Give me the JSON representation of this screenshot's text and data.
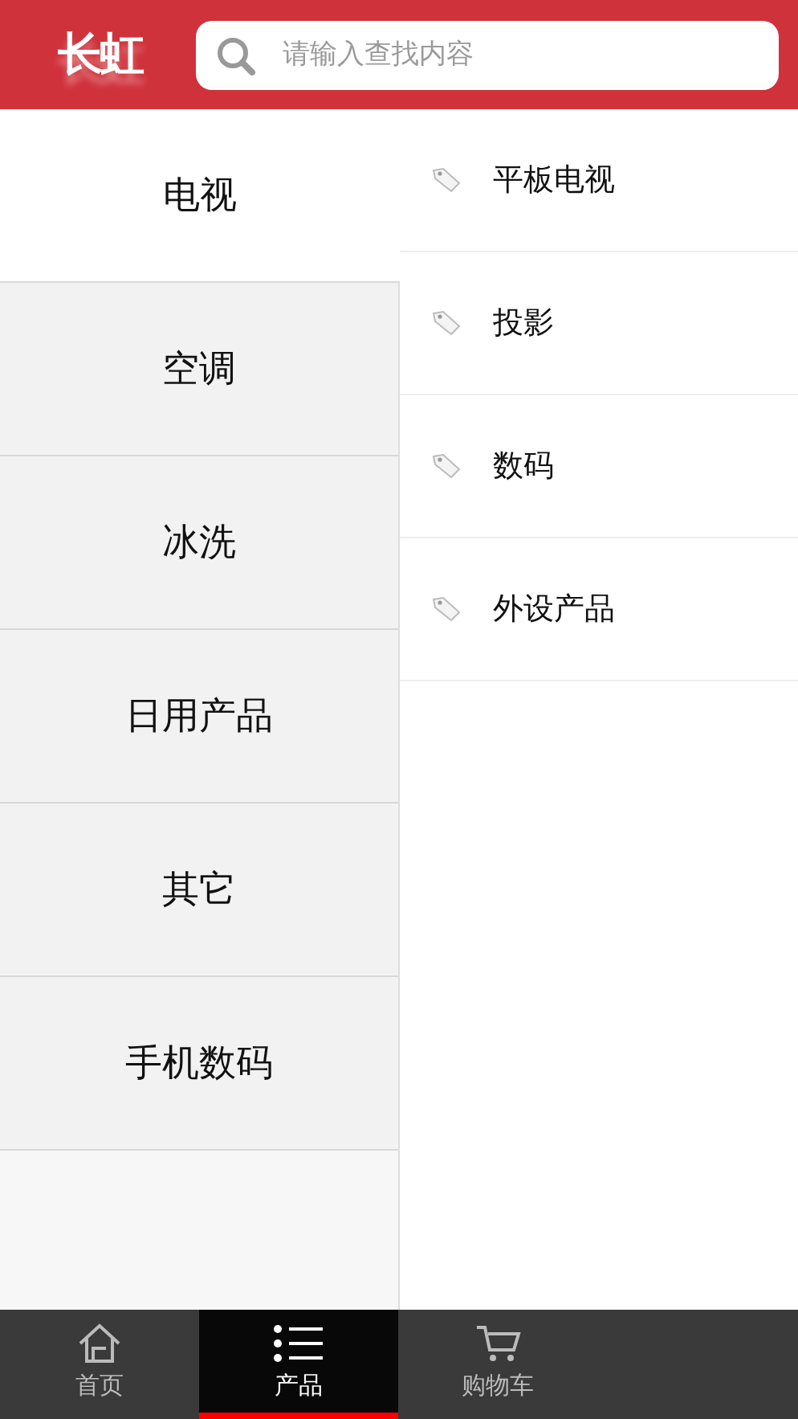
{
  "header": {
    "logo": "长虹",
    "search": {
      "placeholder": "请输入查找内容"
    }
  },
  "categories": [
    {
      "label": "电视",
      "selected": true
    },
    {
      "label": "空调",
      "selected": false
    },
    {
      "label": "冰洗",
      "selected": false
    },
    {
      "label": "日用产品",
      "selected": false
    },
    {
      "label": "其它",
      "selected": false
    },
    {
      "label": "手机数码",
      "selected": false
    }
  ],
  "subcategories": [
    {
      "label": "平板电视"
    },
    {
      "label": "投影"
    },
    {
      "label": "数码"
    },
    {
      "label": "外设产品"
    }
  ],
  "tab_bar": [
    {
      "label": "首页",
      "kind": "home",
      "selected": false
    },
    {
      "label": "产品",
      "kind": "list",
      "selected": true
    },
    {
      "label": "购物车",
      "kind": "cart",
      "selected": false
    }
  ]
}
